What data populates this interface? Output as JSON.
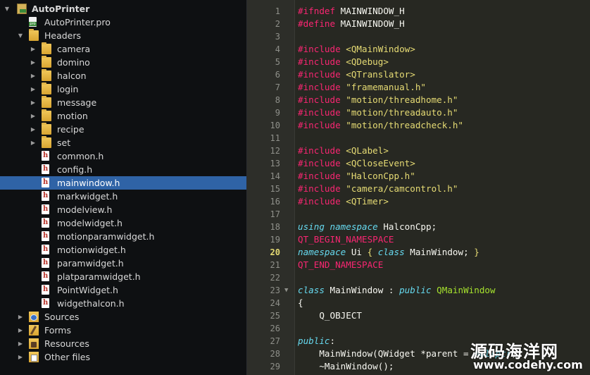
{
  "project_tree": {
    "root": {
      "label": "AutoPrinter",
      "expanded": true
    },
    "items": [
      {
        "label": "AutoPrinter.pro",
        "kind": "pro",
        "depth": 1,
        "arrow": ""
      },
      {
        "label": "Headers",
        "kind": "folder",
        "depth": 1,
        "arrow": "down"
      },
      {
        "label": "camera",
        "kind": "folder",
        "depth": 2,
        "arrow": "right"
      },
      {
        "label": "domino",
        "kind": "folder",
        "depth": 2,
        "arrow": "right"
      },
      {
        "label": "halcon",
        "kind": "folder",
        "depth": 2,
        "arrow": "right"
      },
      {
        "label": "login",
        "kind": "folder",
        "depth": 2,
        "arrow": "right"
      },
      {
        "label": "message",
        "kind": "folder",
        "depth": 2,
        "arrow": "right"
      },
      {
        "label": "motion",
        "kind": "folder",
        "depth": 2,
        "arrow": "right"
      },
      {
        "label": "recipe",
        "kind": "folder",
        "depth": 2,
        "arrow": "right"
      },
      {
        "label": "set",
        "kind": "folder",
        "depth": 2,
        "arrow": "right"
      },
      {
        "label": "common.h",
        "kind": "header",
        "depth": 2,
        "arrow": ""
      },
      {
        "label": "config.h",
        "kind": "header",
        "depth": 2,
        "arrow": ""
      },
      {
        "label": "mainwindow.h",
        "kind": "header",
        "depth": 2,
        "arrow": "",
        "selected": true
      },
      {
        "label": "markwidget.h",
        "kind": "header",
        "depth": 2,
        "arrow": ""
      },
      {
        "label": "modelview.h",
        "kind": "header",
        "depth": 2,
        "arrow": ""
      },
      {
        "label": "modelwidget.h",
        "kind": "header",
        "depth": 2,
        "arrow": ""
      },
      {
        "label": "motionparamwidget.h",
        "kind": "header",
        "depth": 2,
        "arrow": ""
      },
      {
        "label": "motionwidget.h",
        "kind": "header",
        "depth": 2,
        "arrow": ""
      },
      {
        "label": "paramwidget.h",
        "kind": "header",
        "depth": 2,
        "arrow": ""
      },
      {
        "label": "platparamwidget.h",
        "kind": "header",
        "depth": 2,
        "arrow": ""
      },
      {
        "label": "PointWidget.h",
        "kind": "header",
        "depth": 2,
        "arrow": ""
      },
      {
        "label": "widgethalcon.h",
        "kind": "header",
        "depth": 2,
        "arrow": ""
      },
      {
        "label": "Sources",
        "kind": "sources",
        "depth": 1,
        "arrow": "right"
      },
      {
        "label": "Forms",
        "kind": "forms",
        "depth": 1,
        "arrow": "right"
      },
      {
        "label": "Resources",
        "kind": "resources",
        "depth": 1,
        "arrow": "right"
      },
      {
        "label": "Other files",
        "kind": "other",
        "depth": 1,
        "arrow": "right"
      }
    ]
  },
  "editor": {
    "current_line": 20,
    "lines": [
      {
        "n": "1",
        "tokens": [
          [
            "pp",
            "#ifndef "
          ],
          [
            "plain",
            "MAINWINDOW_H"
          ]
        ]
      },
      {
        "n": "2",
        "tokens": [
          [
            "pp",
            "#define "
          ],
          [
            "plain",
            "MAINWINDOW_H"
          ]
        ]
      },
      {
        "n": "3",
        "tokens": []
      },
      {
        "n": "4",
        "tokens": [
          [
            "pp",
            "#include "
          ],
          [
            "str",
            "<QMainWindow>"
          ]
        ]
      },
      {
        "n": "5",
        "tokens": [
          [
            "pp",
            "#include "
          ],
          [
            "str",
            "<QDebug>"
          ]
        ]
      },
      {
        "n": "6",
        "tokens": [
          [
            "pp",
            "#include "
          ],
          [
            "str",
            "<QTranslator>"
          ]
        ]
      },
      {
        "n": "7",
        "tokens": [
          [
            "pp",
            "#include "
          ],
          [
            "str",
            "\"framemanual.h\""
          ]
        ]
      },
      {
        "n": "8",
        "tokens": [
          [
            "pp",
            "#include "
          ],
          [
            "str",
            "\"motion/threadhome.h\""
          ]
        ]
      },
      {
        "n": "9",
        "tokens": [
          [
            "pp",
            "#include "
          ],
          [
            "str",
            "\"motion/threadauto.h\""
          ]
        ]
      },
      {
        "n": "10",
        "tokens": [
          [
            "pp",
            "#include "
          ],
          [
            "str",
            "\"motion/threadcheck.h\""
          ]
        ]
      },
      {
        "n": "11",
        "tokens": []
      },
      {
        "n": "12",
        "tokens": [
          [
            "pp",
            "#include "
          ],
          [
            "str",
            "<QLabel>"
          ]
        ]
      },
      {
        "n": "13",
        "tokens": [
          [
            "pp",
            "#include "
          ],
          [
            "str",
            "<QCloseEvent>"
          ]
        ]
      },
      {
        "n": "14",
        "tokens": [
          [
            "pp",
            "#include "
          ],
          [
            "str",
            "\"HalconCpp.h\""
          ]
        ]
      },
      {
        "n": "15",
        "tokens": [
          [
            "pp",
            "#include "
          ],
          [
            "str",
            "\"camera/camcontrol.h\""
          ]
        ]
      },
      {
        "n": "16",
        "tokens": [
          [
            "pp",
            "#include "
          ],
          [
            "str",
            "<QTimer>"
          ]
        ]
      },
      {
        "n": "17",
        "tokens": []
      },
      {
        "n": "18",
        "tokens": [
          [
            "kw",
            "using namespace "
          ],
          [
            "plain",
            "HalconCpp;"
          ]
        ]
      },
      {
        "n": "19",
        "tokens": [
          [
            "qt",
            "QT_BEGIN_NAMESPACE"
          ]
        ]
      },
      {
        "n": "20",
        "tokens": [
          [
            "kw",
            "namespace "
          ],
          [
            "plain",
            "Ui "
          ],
          [
            "str",
            "{ "
          ],
          [
            "kw",
            "class "
          ],
          [
            "plain",
            "MainWindow; "
          ],
          [
            "str",
            "}"
          ]
        ]
      },
      {
        "n": "21",
        "tokens": [
          [
            "qt",
            "QT_END_NAMESPACE"
          ]
        ]
      },
      {
        "n": "22",
        "tokens": []
      },
      {
        "n": "23",
        "fold": true,
        "tokens": [
          [
            "kw",
            "class "
          ],
          [
            "plain",
            "MainWindow : "
          ],
          [
            "kw",
            "public "
          ],
          [
            "base",
            "QMainWindow"
          ]
        ]
      },
      {
        "n": "24",
        "tokens": [
          [
            "plain",
            "{"
          ]
        ]
      },
      {
        "n": "25",
        "tokens": [
          [
            "plain",
            "    Q_OBJECT"
          ]
        ]
      },
      {
        "n": "26",
        "tokens": []
      },
      {
        "n": "27",
        "tokens": [
          [
            "kw",
            "public"
          ],
          [
            "plain",
            ":"
          ]
        ]
      },
      {
        "n": "28",
        "tokens": [
          [
            "plain",
            "    MainWindow(QWidget *parent = "
          ],
          [
            "kw",
            "nullptr"
          ],
          [
            "plain",
            ");"
          ]
        ]
      },
      {
        "n": "29",
        "tokens": [
          [
            "plain",
            "    ~MainWindow();"
          ]
        ]
      }
    ]
  },
  "watermark": {
    "title": "源码海洋网",
    "url": "www.codehy.com"
  },
  "colors": {
    "selection": "#2f63a6",
    "editor_bg": "#272822",
    "preprocessor": "#f92672",
    "string": "#e6db74",
    "keyword": "#66d9ef"
  }
}
